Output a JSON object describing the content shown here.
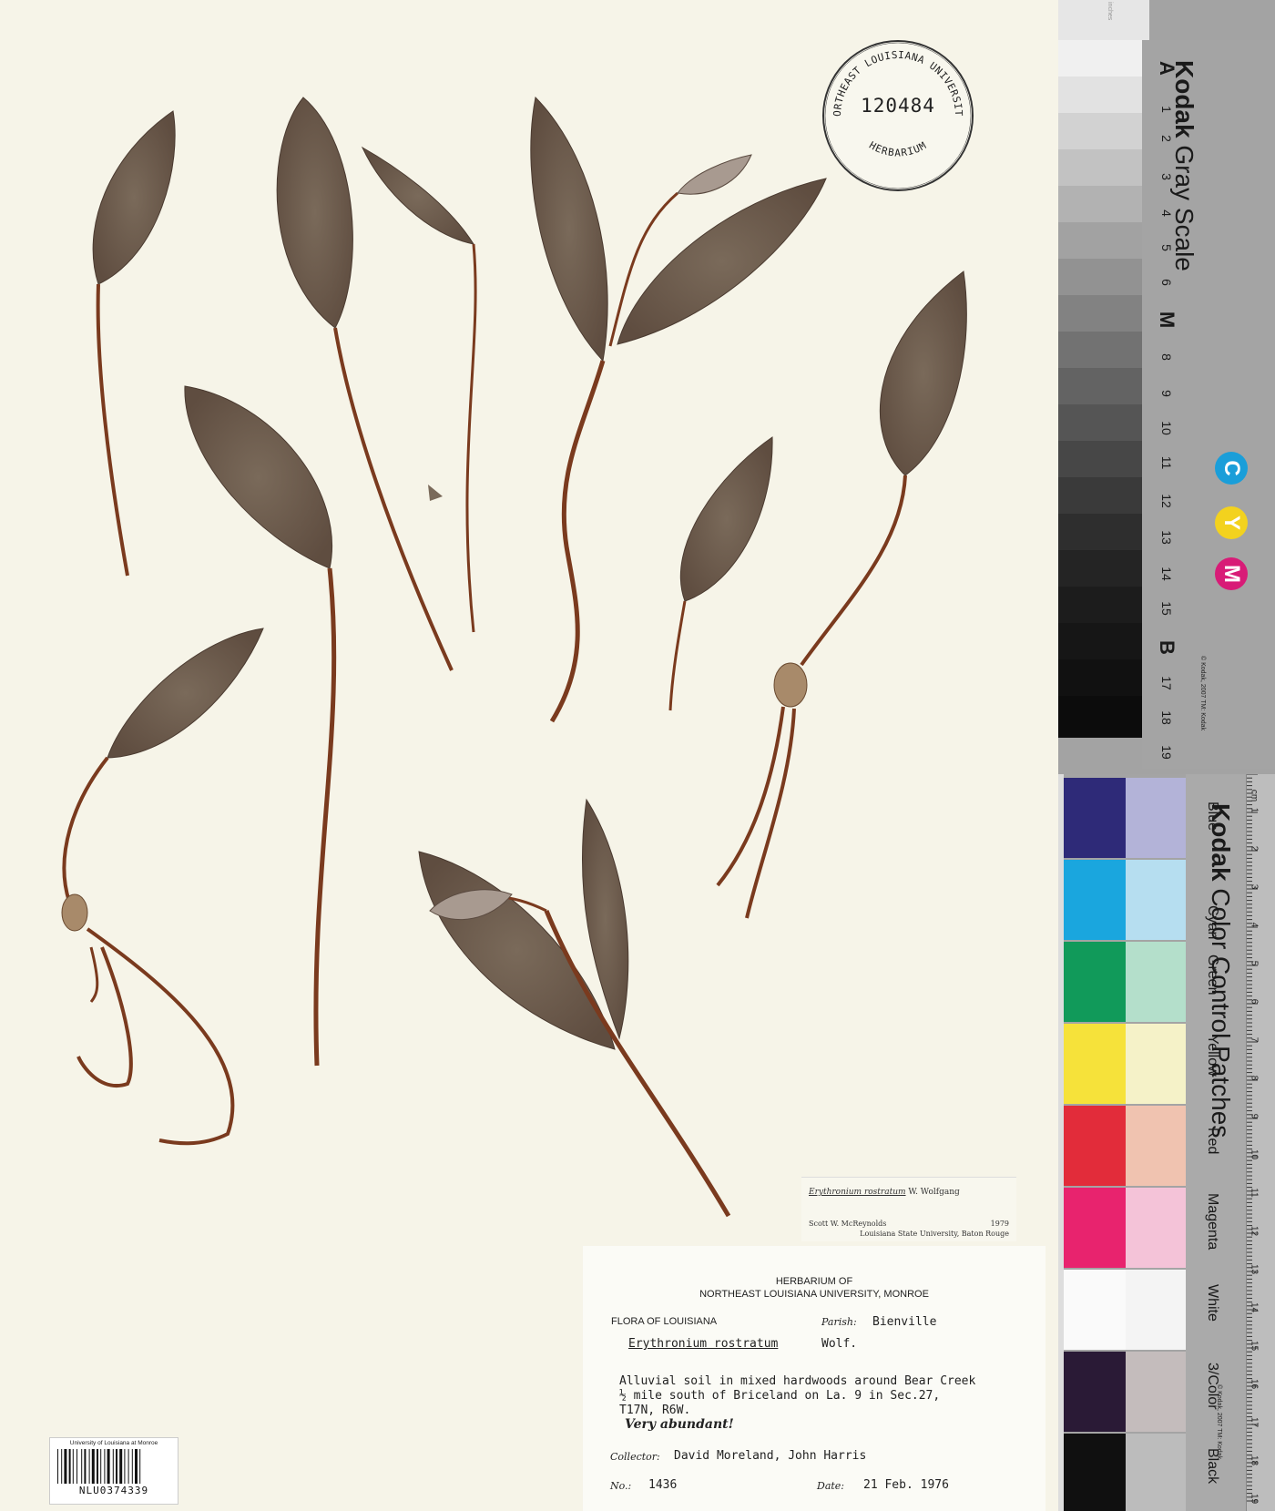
{
  "stamp": {
    "ring_text": "NORTHEAST LOUISIANA UNIVERSITY",
    "number": "120484",
    "bottom_text": "HERBARIUM"
  },
  "determination": {
    "name": "Erythronium rostratum",
    "determiner": "W. Wolfgang",
    "person": "Scott W. McReynolds",
    "year": "1979",
    "institution": "Louisiana State University, Baton Rouge"
  },
  "label": {
    "header_line1": "HERBARIUM OF",
    "header_line2": "NORTHEAST LOUISIANA UNIVERSITY, MONROE",
    "flora": "FLORA OF LOUISIANA",
    "parish_caption": "Parish:",
    "parish": "Bienville",
    "taxon": "Erythronium rostratum",
    "authority": "Wolf.",
    "habitat_line1": "Alluvial soil in mixed hardwoods around Bear Creek",
    "habitat_line2": "½ mile south of Briceland on La. 9 in Sec.27,",
    "habitat_line3": "T17N, R6W.",
    "note": "Very abundant!",
    "collector_caption": "Collector:",
    "collector": "David Moreland, John Harris",
    "number_caption": "No.:",
    "number": "1436",
    "date_caption": "Date:",
    "date": "21 Feb. 1976"
  },
  "barcode": {
    "institution": "University of Louisiana at Monroe",
    "code": "NLU0374339"
  },
  "gray_scale": {
    "corner_text": "inches",
    "brand": "Kodak",
    "title": "Gray Scale",
    "steps": [
      "A",
      "1",
      "2",
      "3",
      "4",
      "5",
      "6",
      "M",
      "8",
      "9",
      "10",
      "11",
      "12",
      "13",
      "14",
      "15",
      "B",
      "17",
      "18",
      "19"
    ],
    "cym": [
      "C",
      "Y",
      "M"
    ],
    "copyright": "© Kodak, 2007 TM: Kodak"
  },
  "color_control": {
    "brand": "Kodak",
    "title": "Color Control Patches",
    "patches": [
      "Blue",
      "Cyan",
      "Green",
      "Yellow",
      "Red",
      "Magenta",
      "White",
      "3/Color",
      "Black"
    ],
    "ruler_units": "cm",
    "ruler_numbers": [
      "1",
      "2",
      "3",
      "4",
      "5",
      "6",
      "7",
      "8",
      "9",
      "10",
      "11",
      "12",
      "13",
      "14",
      "15",
      "16",
      "17",
      "18",
      "19"
    ],
    "copyright": "© Kodak, 2007 TM: Kodak"
  },
  "colors": {
    "leaf": "#6e5c4e",
    "stem": "#7a3a1e",
    "paper": "#f6f4e8"
  }
}
